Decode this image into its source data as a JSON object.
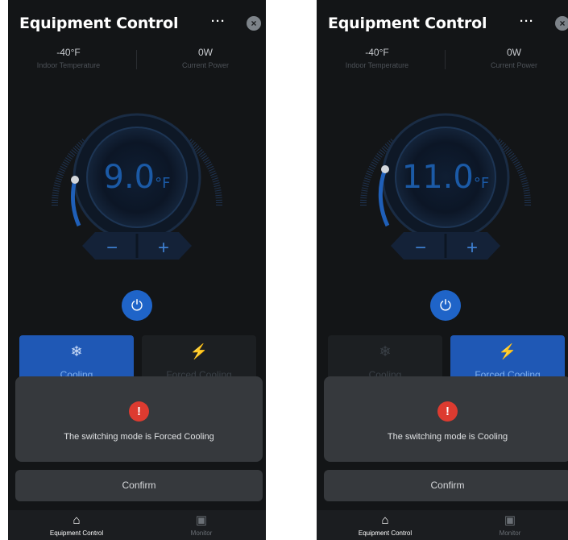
{
  "screens": [
    {
      "title": "Equipment Control",
      "more_label": "···",
      "close_label": "×",
      "indoor_temp_value": "-40°F",
      "indoor_temp_label": "Indoor Temperature",
      "power_value": "0W",
      "power_label": "Current Power",
      "setpoint_value": "9.0",
      "setpoint_unit": "°F",
      "setpoint_fill": 0.3,
      "minus_label": "−",
      "plus_label": "+",
      "power_icon": "⏻",
      "modes": [
        {
          "label": "Cooling",
          "icon": "❄",
          "active": true
        },
        {
          "label": "Forced Cooling",
          "icon": "⚡",
          "active": false
        }
      ],
      "dialog_icon": "!",
      "dialog_message": "The switching mode is Forced Cooling",
      "confirm_label": "Confirm",
      "tabs": [
        {
          "label": "Equipment Control",
          "icon": "⌂",
          "active": true
        },
        {
          "label": "Monitor",
          "icon": "▣",
          "active": false
        }
      ]
    },
    {
      "title": "Equipment Control",
      "more_label": "···",
      "close_label": "×",
      "indoor_temp_value": "-40°F",
      "indoor_temp_label": "Indoor Temperature",
      "power_value": "0W",
      "power_label": "Current Power",
      "setpoint_value": "11.0",
      "setpoint_unit": "°F",
      "setpoint_fill": 0.36,
      "minus_label": "−",
      "plus_label": "+",
      "power_icon": "⏻",
      "modes": [
        {
          "label": "Cooling",
          "icon": "❄",
          "active": false
        },
        {
          "label": "Forced Cooling",
          "icon": "⚡",
          "active": true
        }
      ],
      "dialog_icon": "!",
      "dialog_message": "The switching mode is Cooling",
      "confirm_label": "Confirm",
      "tabs": [
        {
          "label": "Equipment Control",
          "icon": "⌂",
          "active": true
        },
        {
          "label": "Monitor",
          "icon": "▣",
          "active": false
        }
      ]
    }
  ],
  "colors": {
    "background": "#131517",
    "accent": "#1f64c8",
    "temperature": "#1b5aa6",
    "dialog": "#36393d",
    "warning": "#dd3b30"
  }
}
